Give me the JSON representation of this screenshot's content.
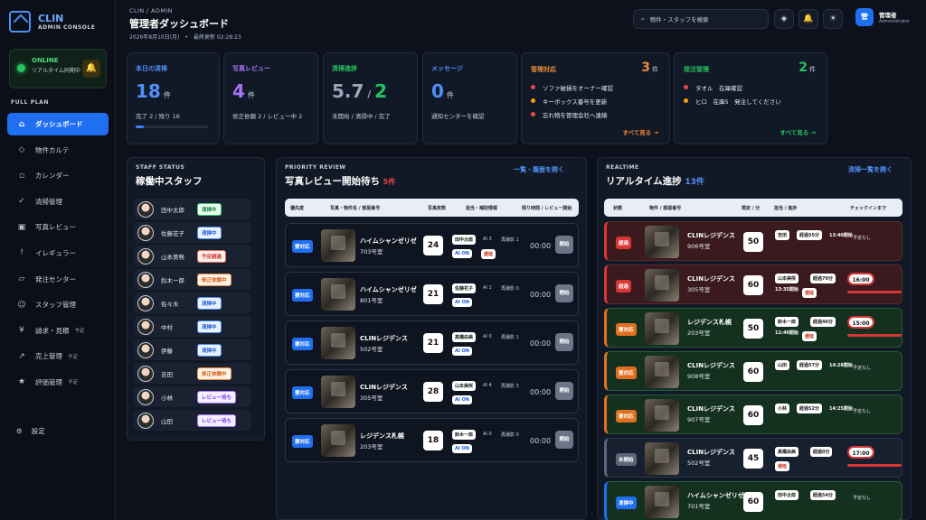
{
  "brand": {
    "name": "CLIN",
    "sub": "ADMIN CONSOLE"
  },
  "online": {
    "title": "ONLINE",
    "desc": "リアルタイム同期中"
  },
  "plan": "FULL PLAN",
  "nav": [
    {
      "label": "ダッシュボード",
      "icon": "home-icon",
      "glyph": "⌂",
      "active": true,
      "tag": ""
    },
    {
      "label": "物件カルテ",
      "icon": "diamond-icon",
      "glyph": "◇",
      "tag": ""
    },
    {
      "label": "カレンダー",
      "icon": "calendar-icon",
      "glyph": "▫",
      "tag": ""
    },
    {
      "label": "清掃管理",
      "icon": "check-icon",
      "glyph": "✓",
      "tag": ""
    },
    {
      "label": "写真レビュー",
      "icon": "photo-icon",
      "glyph": "▣",
      "tag": ""
    },
    {
      "label": "イレギュラー",
      "icon": "alert-icon",
      "glyph": "!",
      "tag": ""
    },
    {
      "label": "発注センター",
      "icon": "order-icon",
      "glyph": "▱",
      "tag": ""
    },
    {
      "label": "スタッフ管理",
      "icon": "staff-icon",
      "glyph": "☺",
      "tag": ""
    },
    {
      "label": "請求・見積",
      "icon": "yen-icon",
      "glyph": "¥",
      "tag": "予定"
    },
    {
      "label": "売上管理",
      "icon": "trend-icon",
      "glyph": "↗",
      "tag": "予定"
    },
    {
      "label": "評価管理",
      "icon": "star-icon",
      "glyph": "★",
      "tag": "予定"
    }
  ],
  "settings": "設定",
  "header": {
    "crumb": "CLIN / ADMIN",
    "title": "管理者ダッシュボード",
    "date": "2026年8月10日(月)　•　最終更新 02:28:23",
    "search_placeholder": "物件・スタッフを検索",
    "user": "管理者",
    "role": "Administrator",
    "avatar": "管"
  },
  "kpis": [
    {
      "label": "本日の清掃",
      "value": "18",
      "unit": "件",
      "sub": "完了 2 / 残り 16",
      "color": "#4f8ff7",
      "progress": 0.11
    },
    {
      "label": "写真レビュー",
      "value": "4",
      "unit": "件",
      "sub": "修正依頼 2 / レビュー中 2",
      "color": "#a574f5"
    },
    {
      "label": "清掃進捗",
      "value": "5.7",
      "value2": "2",
      "sub": "未開始 / 清掃中 / 完了",
      "color": "#9aa6ba"
    },
    {
      "label": "メッセージ",
      "value": "0",
      "unit": "件",
      "sub": "通知センターを確認",
      "color": "#4f8ff7"
    }
  ],
  "alerts": {
    "label": "管理対応",
    "count": "3",
    "unit": "件",
    "items": [
      "ソファ破損をオーナー確認",
      "キーボックス番号を更新",
      "忘れ物を管理会社へ連絡"
    ],
    "more": "すべて見る →"
  },
  "orders": {
    "label": "発注管理",
    "count": "2",
    "unit": "件",
    "items": [
      "タオル　在庫確認",
      "ヒロ　在庫5　発注してください"
    ],
    "more": "すべて見る →"
  },
  "staff": {
    "caption": "STAFF STATUS",
    "title": "稼働中スタッフ",
    "rows": [
      {
        "name": "田中太郎",
        "status": "清掃中",
        "cls": "p-green"
      },
      {
        "name": "佐藤花子",
        "status": "清掃中",
        "cls": "p-blue"
      },
      {
        "name": "山本美咲",
        "status": "予定超過",
        "cls": "p-red"
      },
      {
        "name": "鈴木一郎",
        "status": "修正依頼中",
        "cls": "p-orange"
      },
      {
        "name": "佐々木",
        "status": "清掃中",
        "cls": "p-blue"
      },
      {
        "name": "中村",
        "status": "清掃中",
        "cls": "p-blue"
      },
      {
        "name": "伊藤",
        "status": "清掃中",
        "cls": "p-blue"
      },
      {
        "name": "吉田",
        "status": "修正依頼中",
        "cls": "p-orange"
      },
      {
        "name": "小林",
        "status": "レビュー待ち",
        "cls": "p-purple"
      },
      {
        "name": "山田",
        "status": "レビュー待ち",
        "cls": "p-purple"
      }
    ]
  },
  "review": {
    "caption": "PRIORITY REVIEW",
    "title": "写真レビュー開始待ち",
    "count": "5件",
    "link": "一覧・履歴を開く",
    "headers": [
      "優先度",
      "写真・物件名 / 部屋番号",
      "写真枚数",
      "担当・補助情報",
      "残り時間 / レビュー開始"
    ],
    "rows": [
      {
        "badge": "要対応",
        "name": "ハイムシャンゼリゼ",
        "room": "703号室",
        "photos": "24",
        "staff": "田中太郎",
        "ai": "AI 3",
        "redo": "再撮影 1",
        "aion": "AI ON",
        "late": "遅延",
        "timer": "00:00",
        "btn": "開始"
      },
      {
        "badge": "要対応",
        "name": "ハイムシャンゼリゼ",
        "room": "801号室",
        "photos": "21",
        "staff": "佐藤花子",
        "ai": "AI 1",
        "redo": "再撮影 0",
        "aion": "AI ON",
        "late": "",
        "timer": "00:00",
        "btn": "開始"
      },
      {
        "badge": "要対応",
        "name": "CLINレジデンス",
        "room": "502号室",
        "photos": "21",
        "staff": "高橋由美",
        "ai": "AI 0",
        "redo": "再撮影 1",
        "aion": "AI ON",
        "late": "",
        "timer": "00:00",
        "btn": "開始"
      },
      {
        "badge": "要対応",
        "name": "CLINレジデンス",
        "room": "305号室",
        "photos": "28",
        "staff": "山本美咲",
        "ai": "AI 4",
        "redo": "再撮影 3",
        "aion": "AI ON",
        "late": "",
        "timer": "00:00",
        "btn": "開始"
      },
      {
        "badge": "要対応",
        "name": "レジデンス札幌",
        "room": "203号室",
        "photos": "18",
        "staff": "鈴木一郎",
        "ai": "AI 0",
        "redo": "再撮影 0",
        "aion": "AI ON",
        "late": "",
        "timer": "00:00",
        "btn": "開始"
      }
    ]
  },
  "realtime": {
    "caption": "REALTIME",
    "title": "リアルタイム進捗",
    "count": "13件",
    "link": "清掃一覧を開く",
    "headers": [
      "状態",
      "物件 / 部屋番号",
      "規定 / 分",
      "担当 / 進捗",
      "チェックインまで"
    ],
    "rows": [
      {
        "state": "超過",
        "stateColor": "#d93636",
        "bg": "#3a1a1e",
        "border": "#5a2a2e",
        "name": "CLINレジデンス",
        "room": "906号室",
        "mins": "50",
        "staff": "吉田",
        "elapsed": "経過55分",
        "start": "13:40開始",
        "flag": "",
        "checkin": "",
        "nodue": "予定なし"
      },
      {
        "state": "超過",
        "stateColor": "#d93636",
        "bg": "#3a1a1e",
        "border": "#5a2a2e",
        "name": "CLINレジデンス",
        "room": "305号室",
        "mins": "60",
        "staff": "山本美咲",
        "elapsed": "経過70分",
        "start": "13:35開始",
        "flag": "遅延",
        "checkin": "16:00",
        "nodue": ""
      },
      {
        "state": "要対応",
        "stateColor": "#e0701f",
        "bg": "#14301f",
        "border": "#2b5a3a",
        "name": "レジデンス札幌",
        "room": "203号室",
        "mins": "50",
        "staff": "鈴木一郎",
        "elapsed": "経過46分",
        "start": "12:40開始",
        "flag": "遅延",
        "checkin": "15:00",
        "nodue": ""
      },
      {
        "state": "要対応",
        "stateColor": "#e0701f",
        "bg": "#14301f",
        "border": "#2b5a3a",
        "name": "CLINレジデンス",
        "room": "908号室",
        "mins": "60",
        "staff": "山田",
        "elapsed": "経過57分",
        "start": "14:28開始",
        "flag": "",
        "checkin": "",
        "nodue": "予定なし"
      },
      {
        "state": "要対応",
        "stateColor": "#e0701f",
        "bg": "#14301f",
        "border": "#2b5a3a",
        "name": "CLINレジデンス",
        "room": "907号室",
        "mins": "60",
        "staff": "小林",
        "elapsed": "経過52分",
        "start": "14:25開始",
        "flag": "",
        "checkin": "",
        "nodue": "予定なし"
      },
      {
        "state": "未開始",
        "stateColor": "#5b6679",
        "bg": "#16202e",
        "border": "#2c3648",
        "name": "CLINレジデンス",
        "room": "502号室",
        "mins": "45",
        "staff": "高橋由美",
        "elapsed": "経過0分",
        "start": "",
        "flag": "遅延",
        "checkin": "17:00",
        "nodue": ""
      },
      {
        "state": "清掃中",
        "stateColor": "#1f6ff0",
        "bg": "#14301f",
        "border": "#2b5a3a",
        "name": "ハイムシャンゼリゼ",
        "room": "701号室",
        "mins": "60",
        "staff": "田中太郎",
        "elapsed": "経過54分",
        "start": "",
        "flag": "",
        "checkin": "",
        "nodue": "予定なし"
      }
    ]
  }
}
